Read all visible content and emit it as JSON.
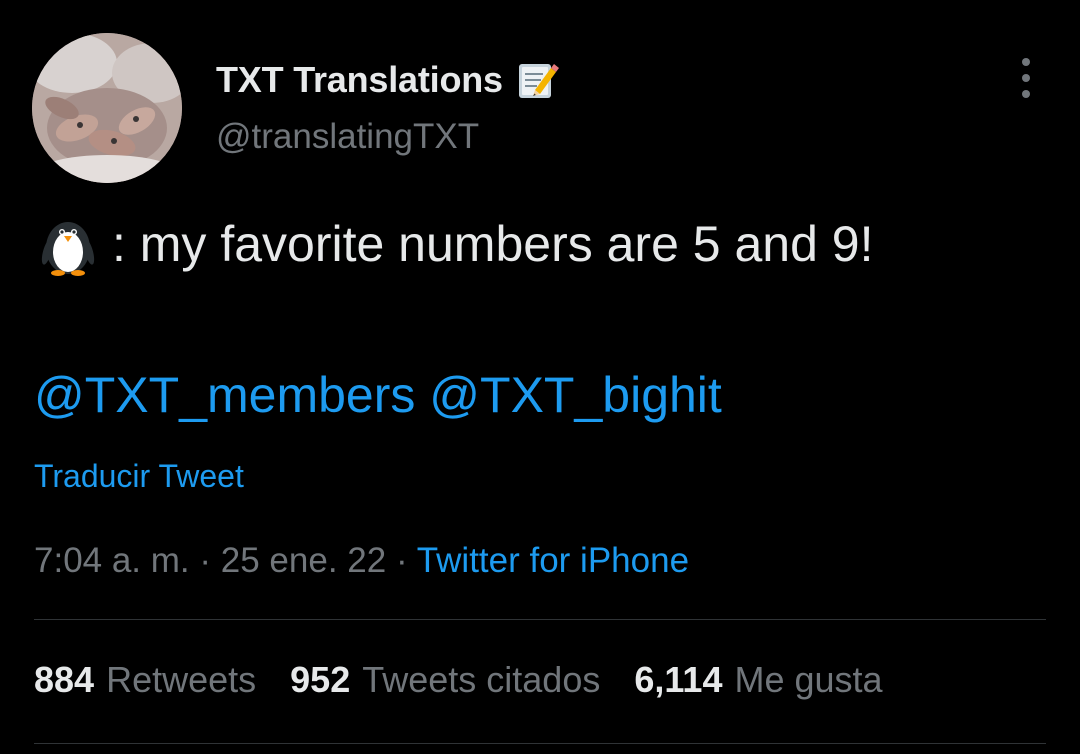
{
  "author": {
    "display_name": "TXT Translations",
    "username": "@translatingTXT",
    "name_emoji": "memo-icon",
    "avatar": "avatar-photo"
  },
  "tweet": {
    "emoji": "penguin-icon",
    "text": ": my favorite numbers are 5 and 9!",
    "mentions": [
      "@TXT_members",
      "@TXT_bighit"
    ],
    "translate_label": "Traducir Tweet"
  },
  "meta": {
    "time": "7:04 a. m.",
    "separator": "·",
    "date": "25 ene. 22",
    "source": "Twitter for iPhone"
  },
  "stats": [
    {
      "count": "884",
      "label": "Retweets"
    },
    {
      "count": "952",
      "label": "Tweets citados"
    },
    {
      "count": "6,114",
      "label": "Me gusta"
    }
  ],
  "colors": {
    "background": "#000000",
    "text_primary": "#e7e9ea",
    "text_secondary": "#71767b",
    "accent": "#1d9bf0",
    "divider": "#2f3336"
  }
}
